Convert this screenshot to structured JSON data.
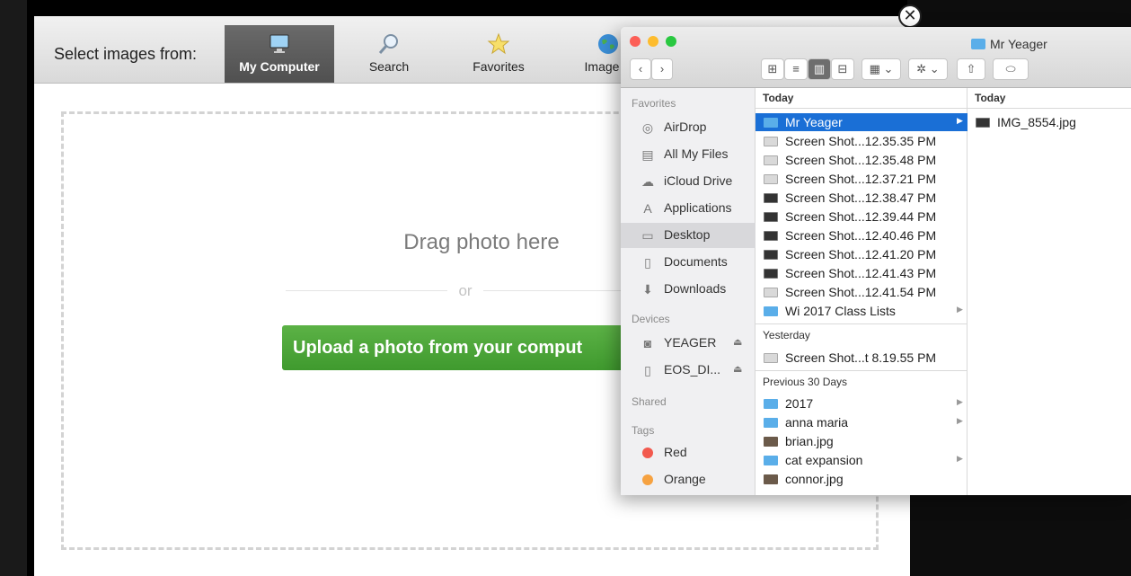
{
  "picker": {
    "select_label": "Select images from:",
    "tabs": [
      {
        "label": "My Computer",
        "icon": "monitor-icon",
        "active": true
      },
      {
        "label": "Search",
        "icon": "magnifier-icon",
        "active": false
      },
      {
        "label": "Favorites",
        "icon": "star-icon",
        "active": false
      },
      {
        "label": "Image U",
        "icon": "globe-icon",
        "active": false
      }
    ],
    "drag_text": "Drag photo here",
    "or_text": "or",
    "upload_button": "Upload a photo from your comput",
    "close_glyph": "✕"
  },
  "finder": {
    "title": "Mr Yeager",
    "toolbar": {
      "back": "‹",
      "forward": "›",
      "views": [
        "⊞",
        "≡",
        "▥",
        "⊟"
      ],
      "arrange": "▦ ⌄",
      "action": "✲ ⌄",
      "share": "⇧",
      "tag": "⬭"
    },
    "sidebar": {
      "favorites_header": "Favorites",
      "favorites": [
        {
          "label": "AirDrop",
          "icon": "airdrop-icon",
          "glyph": "◎"
        },
        {
          "label": "All My Files",
          "icon": "all-files-icon",
          "glyph": "▤"
        },
        {
          "label": "iCloud Drive",
          "icon": "cloud-icon",
          "glyph": "☁"
        },
        {
          "label": "Applications",
          "icon": "applications-icon",
          "glyph": "A"
        },
        {
          "label": "Desktop",
          "icon": "desktop-icon",
          "glyph": "▭",
          "selected": true
        },
        {
          "label": "Documents",
          "icon": "documents-icon",
          "glyph": "▯"
        },
        {
          "label": "Downloads",
          "icon": "downloads-icon",
          "glyph": "⬇"
        }
      ],
      "devices_header": "Devices",
      "devices": [
        {
          "label": "YEAGER",
          "icon": "hard-drive-icon",
          "glyph": "◙",
          "eject": "⏏"
        },
        {
          "label": "EOS_DI...",
          "icon": "disk-icon",
          "glyph": "▯",
          "eject": "⏏"
        }
      ],
      "shared_header": "Shared",
      "tags_header": "Tags",
      "tags": [
        {
          "label": "Red",
          "color": "#f2594e"
        },
        {
          "label": "Orange",
          "color": "#f6a241"
        }
      ]
    },
    "column1": {
      "today_header": "Today",
      "today": [
        {
          "label": "Mr Yeager",
          "kind": "folder",
          "selected": true,
          "arrow": "▶"
        },
        {
          "label": "Screen Shot...12.35.35 PM",
          "kind": "shot"
        },
        {
          "label": "Screen Shot...12.35.48 PM",
          "kind": "shot"
        },
        {
          "label": "Screen Shot...12.37.21 PM",
          "kind": "shot"
        },
        {
          "label": "Screen Shot...12.38.47 PM",
          "kind": "shot-dark"
        },
        {
          "label": "Screen Shot...12.39.44 PM",
          "kind": "shot-dark"
        },
        {
          "label": "Screen Shot...12.40.46 PM",
          "kind": "shot-dark"
        },
        {
          "label": "Screen Shot...12.41.20 PM",
          "kind": "shot-dark"
        },
        {
          "label": "Screen Shot...12.41.43 PM",
          "kind": "shot-dark"
        },
        {
          "label": "Screen Shot...12.41.54 PM",
          "kind": "shot"
        },
        {
          "label": "Wi 2017 Class Lists",
          "kind": "folder",
          "arrow": "▶"
        }
      ],
      "yesterday_header": "Yesterday",
      "yesterday": [
        {
          "label": "Screen Shot...t 8.19.55 PM",
          "kind": "shot"
        }
      ],
      "previous_header": "Previous 30 Days",
      "previous": [
        {
          "label": "2017",
          "kind": "folder",
          "arrow": "▶"
        },
        {
          "label": "anna maria",
          "kind": "folder",
          "arrow": "▶"
        },
        {
          "label": "brian.jpg",
          "kind": "photo"
        },
        {
          "label": "cat expansion",
          "kind": "folder",
          "arrow": "▶"
        },
        {
          "label": "connor.jpg",
          "kind": "photo"
        }
      ]
    },
    "column2": {
      "today_header": "Today",
      "items": [
        {
          "label": "IMG_8554.jpg",
          "kind": "shot-dark"
        }
      ]
    }
  }
}
